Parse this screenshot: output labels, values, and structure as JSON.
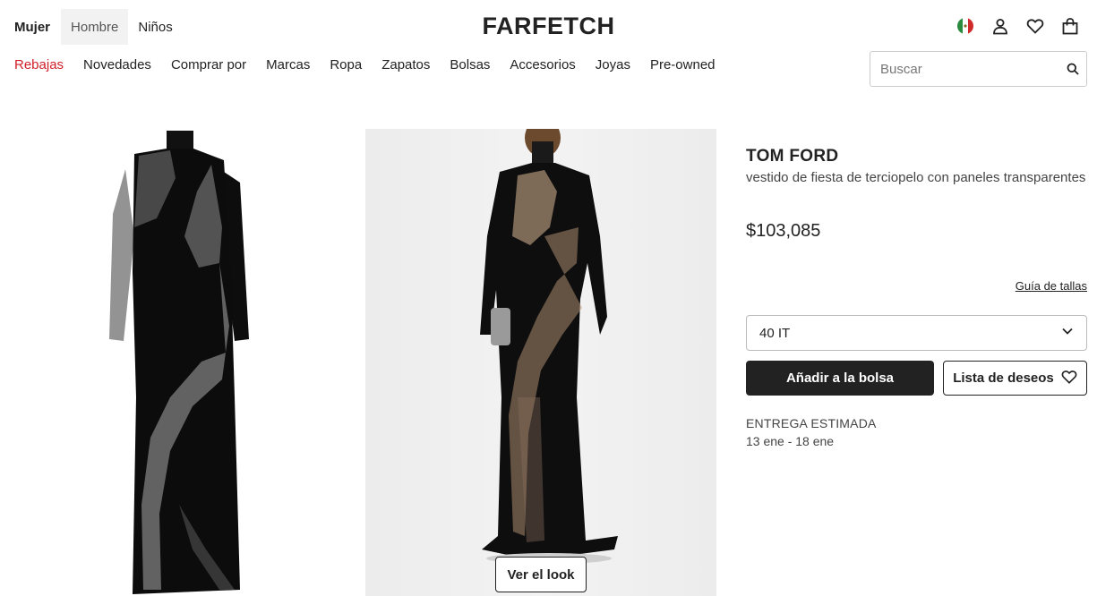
{
  "header": {
    "gender_tabs": [
      {
        "label": "Mujer"
      },
      {
        "label": "Hombre"
      },
      {
        "label": "Niños"
      }
    ],
    "logo": "FARFETCH",
    "icons": [
      "mexico-flag-icon",
      "user-icon",
      "heart-icon",
      "bag-icon"
    ]
  },
  "nav": {
    "items": [
      {
        "label": "Rebajas"
      },
      {
        "label": "Novedades"
      },
      {
        "label": "Comprar por"
      },
      {
        "label": "Marcas"
      },
      {
        "label": "Ropa"
      },
      {
        "label": "Zapatos"
      },
      {
        "label": "Bolsas"
      },
      {
        "label": "Accesorios"
      },
      {
        "label": "Joyas"
      },
      {
        "label": "Pre-owned"
      }
    ]
  },
  "search": {
    "placeholder": "Buscar",
    "value": ""
  },
  "gallery": {
    "look_button": "Ver el look"
  },
  "product": {
    "brand": "TOM FORD",
    "name": "vestido de fiesta de terciopelo con paneles transparentes",
    "price": "$103,085",
    "size_guide": "Guía de tallas",
    "selected_size": "40 IT",
    "add_to_bag": "Añadir a la bolsa",
    "wishlist": "Lista de deseos",
    "delivery_title": "ENTREGA ESTIMADA",
    "delivery_dates": "13 ene - 18 ene"
  },
  "colors": {
    "sale": "#d0202a",
    "primary": "#222222"
  }
}
